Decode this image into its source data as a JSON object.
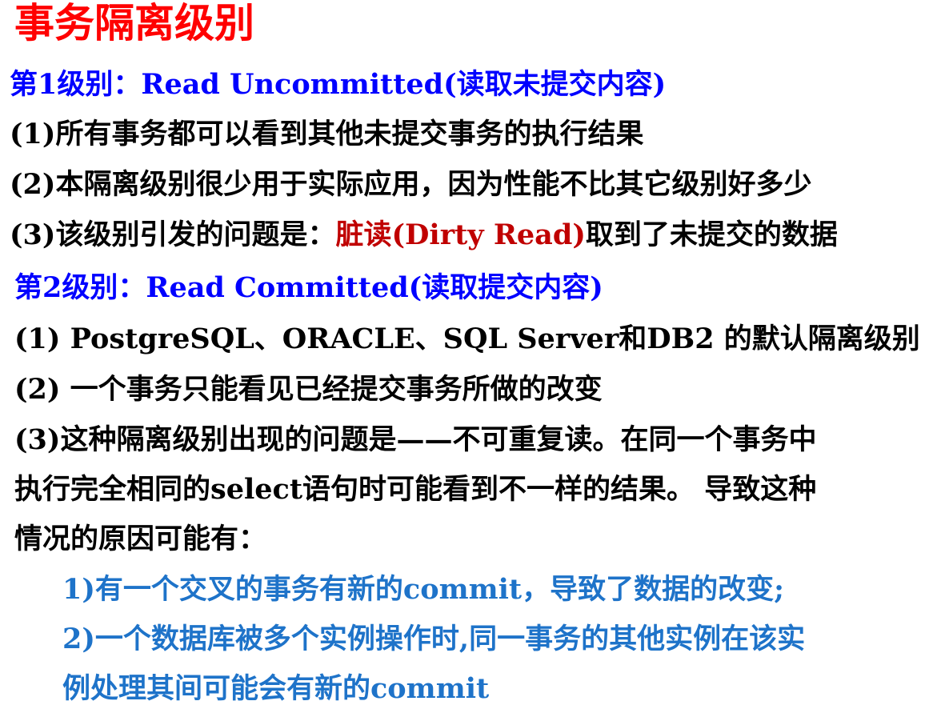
{
  "title": "事务隔离级别",
  "colors": {
    "title": "#ff0000",
    "level_heading": "#0000ff",
    "body": "#000000",
    "highlight": "#c00000",
    "reason": "#1e73c9"
  },
  "level1": {
    "heading": "第1级别：Read Uncommitted(读取未提交内容)",
    "items": [
      "(1)所有事务都可以看到其他未提交事务的执行结果",
      "(2)本隔离级别很少用于实际应用，因为性能不比其它级别好多少"
    ],
    "item3_prefix": "(3)该级别引发的问题是：",
    "item3_highlight": "脏读(Dirty Read)",
    "item3_suffix": "取到了未提交的数据"
  },
  "level2": {
    "heading": "第2级别：Read Committed(读取提交内容)",
    "item1": "(1) PostgreSQL、ORACLE、SQL Server和DB2 的默认隔离级别",
    "item2": "(2) 一个事务只能看见已经提交事务所做的改变",
    "item3_lines": [
      "(3)这种隔离级别出现的问题是——不可重复读。在同一个事务中",
      "执行完全相同的select语句时可能看到不一样的结果。 导致这种",
      "情况的原因可能有："
    ],
    "reasons": [
      "1)有一个交叉的事务有新的commit，导致了数据的改变;",
      "2)一个数据库被多个实例操作时,同一事务的其他实例在该实",
      "例处理其间可能会有新的commit"
    ]
  }
}
